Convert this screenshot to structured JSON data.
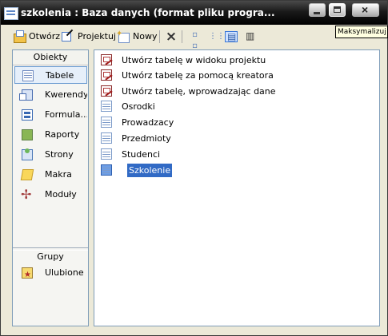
{
  "window": {
    "title": "szkolenia : Baza danych (format pliku progra..."
  },
  "title_buttons": {
    "minimize": "minimize-icon",
    "maximize": "maximize-icon",
    "close": "close-icon"
  },
  "tooltip": {
    "text": "Maksymalizuj"
  },
  "toolbar": {
    "open_label": "Otwórz",
    "design_label": "Projektuj",
    "new_label": "Nowy"
  },
  "left_pane": {
    "objects_header": "Obiekty",
    "items": [
      {
        "label": "Tabele",
        "icon": "table-icon",
        "selected": true
      },
      {
        "label": "Kwerendy",
        "icon": "query-icon"
      },
      {
        "label": "Formula...",
        "icon": "form-icon"
      },
      {
        "label": "Raporty",
        "icon": "report-icon"
      },
      {
        "label": "Strony",
        "icon": "pages-icon"
      },
      {
        "label": "Makra",
        "icon": "macro-icon"
      },
      {
        "label": "Moduły",
        "icon": "modules-icon"
      }
    ],
    "groups_header": "Grupy",
    "favorites": {
      "label": "Ulubione",
      "icon": "favorites-icon"
    }
  },
  "objects": [
    {
      "label": "Utwórz tabelę w widoku projektu",
      "icon": "design-wizard-icon"
    },
    {
      "label": "Utwórz tabelę za pomocą kreatora",
      "icon": "wizard-icon"
    },
    {
      "label": "Utwórz tabelę, wprowadzając dane",
      "icon": "data-entry-icon"
    },
    {
      "label": "Osrodki",
      "icon": "table-icon"
    },
    {
      "label": "Prowadzacy",
      "icon": "table-icon"
    },
    {
      "label": "Przedmioty",
      "icon": "table-icon"
    },
    {
      "label": "Studenci",
      "icon": "table-icon"
    },
    {
      "label": "Szkolenie",
      "icon": "table-icon",
      "selected": true
    }
  ],
  "colors": {
    "titlebar": "#1a1a1a",
    "selection": "#316ac5",
    "pane_border": "#7f9db9"
  }
}
